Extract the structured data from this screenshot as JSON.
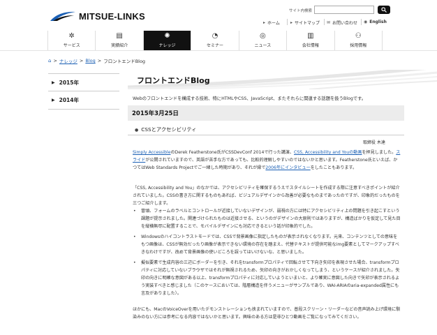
{
  "header": {
    "logo_text": "MITSUE-LINKS",
    "search_label": "サイト内検索",
    "search_placeholder": "",
    "util_links": [
      {
        "label": "ホーム",
        "icon": "arrow-right-icon"
      },
      {
        "label": "サイトマップ",
        "icon": "arrow-right-icon"
      },
      {
        "label": "お問い合わせ",
        "icon": "mail-icon"
      },
      {
        "label": "English",
        "icon": "globe-icon"
      }
    ]
  },
  "nav": [
    {
      "label": "サービス",
      "icon": "cog-icon",
      "active": false
    },
    {
      "label": "実績紹介",
      "icon": "document-icon",
      "active": false
    },
    {
      "label": "ナレッジ",
      "icon": "knowledge-icon",
      "active": true
    },
    {
      "label": "セミナー",
      "icon": "megaphone-icon",
      "active": false
    },
    {
      "label": "ニュース",
      "icon": "news-icon",
      "active": false
    },
    {
      "label": "会社情報",
      "icon": "building-icon",
      "active": false
    },
    {
      "label": "採用情報",
      "icon": "people-icon",
      "active": false
    }
  ],
  "breadcrumb": {
    "items": [
      "ナレッジ",
      "Blog"
    ],
    "current": "フロントエンドBlog",
    "separator": ">"
  },
  "sidebar": {
    "items": [
      {
        "label": "2015年"
      },
      {
        "label": "2014年"
      }
    ]
  },
  "main": {
    "title": "フロントエンドBlog",
    "lead": "Webのフロントエンドを構成する技術、特にHTMLやCSS、JavaScript、またそれらに関連する話題を扱うBlogです。",
    "date": "2015年3月25日",
    "post_title": "CSSとアクセシビリティ",
    "author": "取締役 木達",
    "p1": {
      "link1": "Simply Accessible",
      "t1": "のDerek Featherstone氏がCSSDevConf 2014で行った講演、",
      "link2": "CSS, Accessibility and Youの動画",
      "t2": "を拝見しました。",
      "link3": "スライド",
      "t3": "が公開されていますので、英語が苦手な方であっても、比較的理解しやすいのではないかと思います。Featherstone氏といえば、かつてはWeb Standards Projectでご一緒した時期があり、それが縁で",
      "link4": "2006年にインタビュー",
      "t4": "をしたこともあります。"
    },
    "p2": "「CSS, Accessibility and You」のなかでは、アクセシビリティを確保するうえでスタイルシートを作成する際に注意すべきポイントが紹介されていました。CSSの書き方に関するものもあれば、ビジュアルデザインから改善が必要なものまであったのですが、印象的だったものを三つご紹介します。",
    "bullets": [
      "冒頭、フォームのラベルとコントロールが近接していないデザインが、弱視の方には特にアクセシビリティ上の問題を引き起こすという課題が提示されました。関連づけられたものは近接させる、というのがデザインの大原則ではありますが、構造ばかりを仮定して見た目を縦横無尽に配置することで、モバイルデザインにも対応できるという話が印象的でした。",
      "Windowsのハイコントラストモードでは、CSSで背景画像に指定したものが表示されなくなります。元来、コンテンツとしての意味をもつ画像は、CSSが無効だったり画像が表示できない環境の存在を踏まえ、代替テキストが提供可能なimg要素としてマークアップすべきなわけですが、改めて背景画像の使いどころを誤ってはいけないな、と思いました。",
      "擬似要素で生成内容の三辺にボーダーを引き、それをtransformプロパティで回転させて下向き矢印を表現させた場合、transformプロパティに対応していないブラウザではそれが無視されるため、矢印の向きがおかしくなってしまう、というケースが紹介されました。矢印の向きに明確な意図がある以上、transformプロパティに対応していようといまいと、より確実に意図した向きで矢印が表示されるよう実装すべきと感じました（このケースにおいては、階層構造を伴うメニューがサンプルであり、WAI-ARIAのaria-expanded属性にも言及がありました）。"
    ],
    "p3": "ほかにも、MacのVoiceOverを用いたデモンストレーションも挟まれていますので、普段スクリーン・リーダーなどの音声読み上げ環境に馴染みのない方には参考になる内容ではないかと思います。興味のある方は是非ひとつ動画をご覧になってみてください。"
  },
  "colors": {
    "link": "#1a5fb4",
    "nav_active": "#111111",
    "date_bar": "#ececec"
  }
}
